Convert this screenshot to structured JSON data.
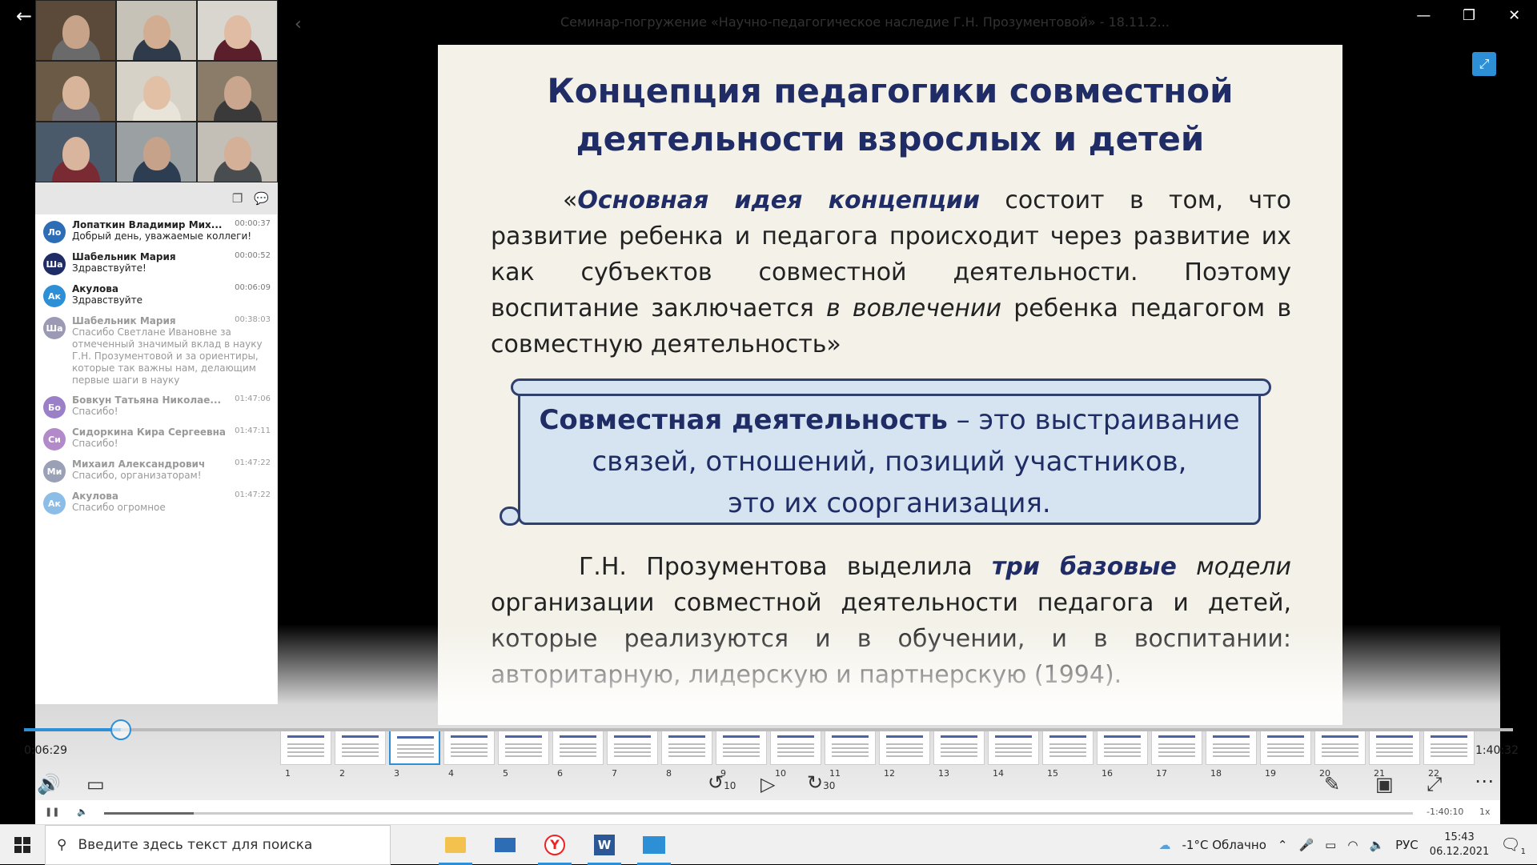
{
  "window": {
    "title": "Семинар-погружение «Научно-педагогическое наследие Г.Н. Прозументовой» - 18.11.2...",
    "minimize": "—",
    "maximize": "❐",
    "close": "✕",
    "back": "←"
  },
  "participants": [
    {
      "skin": "#c7a38a",
      "shirt": "#6a6a6a",
      "bg": "#5b4a3a"
    },
    {
      "skin": "#d3ad92",
      "shirt": "#2f3a4a",
      "bg": "#c7c2b8"
    },
    {
      "skin": "#e0bca4",
      "shirt": "#5a1f2a",
      "bg": "#d9d6cf"
    },
    {
      "skin": "#d8b49b",
      "shirt": "#6d6a70",
      "bg": "#6b5a45"
    },
    {
      "skin": "#e2c0a6",
      "shirt": "#e8e4da",
      "bg": "#d6d2c8"
    },
    {
      "skin": "#c9a68d",
      "shirt": "#3a3a3a",
      "bg": "#8a7c68"
    },
    {
      "skin": "#d9b59d",
      "shirt": "#7a2a33",
      "bg": "#4a5a6a"
    },
    {
      "skin": "#c7a28a",
      "shirt": "#2d3d52",
      "bg": "#9ba1a3"
    },
    {
      "skin": "#d3b097",
      "shirt": "#4a4d4f",
      "bg": "#c3bfb6"
    }
  ],
  "chat": {
    "messages": [
      {
        "initials": "Ло",
        "color": "#2d6db5",
        "name": "Лопаткин Владимир Мих...",
        "time": "00:00:37",
        "text": "Добрый день, уважаемые коллеги!",
        "faded": false
      },
      {
        "initials": "Ша",
        "color": "#1f2c66",
        "name": "Шабельник Мария",
        "time": "00:00:52",
        "text": "Здравствуйте!",
        "faded": false
      },
      {
        "initials": "Ак",
        "color": "#2d8fd6",
        "name": "Акулова",
        "time": "00:06:09",
        "text": "Здравствуйте",
        "faded": false
      },
      {
        "initials": "Ша",
        "color": "#9a9ab5",
        "name": "Шабельник Мария",
        "time": "00:38:03",
        "text": "Спасибо Светлане Ивановне за отмеченный значимый вклад в науку Г.Н. Прозументовой и за ориентиры, которые так важны нам, делающим первые шаги в науку",
        "faded": true
      },
      {
        "initials": "Бо",
        "color": "#9b7fc7",
        "name": "Бовкун Татьяна Николае...",
        "time": "01:47:06",
        "text": "Спасибо!",
        "faded": true
      },
      {
        "initials": "Си",
        "color": "#b28ac9",
        "name": "Сидоркина Кира Сергеевна",
        "time": "01:47:11",
        "text": "Спасибо!",
        "faded": true
      },
      {
        "initials": "Ми",
        "color": "#9aa0b5",
        "name": "Михаил Александрович",
        "time": "01:47:22",
        "text": "Спасибо, организаторам!",
        "faded": true
      },
      {
        "initials": "Ак",
        "color": "#8cbde6",
        "name": "Акулова",
        "time": "01:47:22",
        "text": "Спасибо огромное",
        "faded": true
      }
    ]
  },
  "slide": {
    "title1": "Концепция педагогики совместной",
    "title2": "деятельности взрослых и детей",
    "p1_open": "«",
    "p1_em": "Основная идея концепции",
    "p1_a": " состоит в том, что развитие ребенка и педагога происходит через развитие их как субъектов совместной деятельности. Поэтому воспитание заключается ",
    "p1_it": "в вовлечении",
    "p1_b": " ребенка педагогом в совместную деятельность»",
    "box_bold": "Совместная деятельность",
    "box_rest": " – это выстраивание связей, отношений, позиций участников,",
    "box_line3": "это их соорганизация.",
    "p2_a": "Г.Н. Прозументова выделила ",
    "p2_em": "три базовые",
    "p2_it": " модели",
    "p2_b": " организации совместной деятельности педагога и детей, которые реализуются и в обучении, и в воспитании: авторитарную, лидерскую и партнерскую (1994)."
  },
  "player": {
    "current": "0:06:29",
    "total": "1:40:32",
    "progress": 0.065,
    "mini_right": "-1:40:10",
    "speed": "1x",
    "rewind": "10",
    "forward": "30",
    "thumbs": [
      "1",
      "2",
      "3",
      "4",
      "5",
      "6",
      "7",
      "8",
      "9",
      "10",
      "11",
      "12",
      "13",
      "14",
      "15",
      "16",
      "17",
      "18",
      "19",
      "20",
      "21",
      "22"
    ],
    "active_thumb": 2
  },
  "taskbar": {
    "search_placeholder": "Введите здесь текст для поиска",
    "weather": "-1°C Облачно",
    "lang": "РУС",
    "time": "15:43",
    "date": "06.12.2021",
    "notif": "1"
  }
}
